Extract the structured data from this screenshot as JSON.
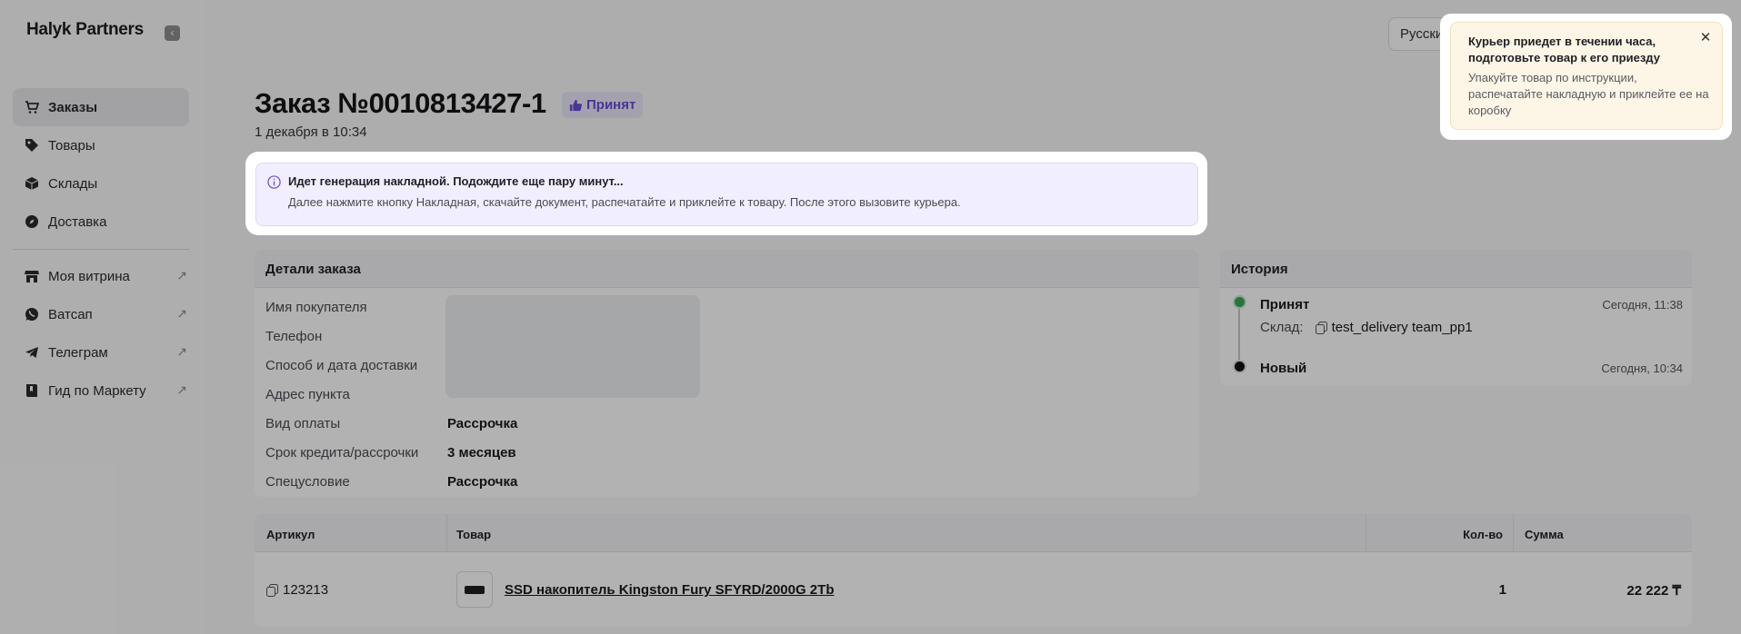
{
  "sidebar": {
    "brand": "Halyk Partners",
    "collapse_icon": "chevron-left-icon",
    "main_items": [
      {
        "label": "Заказы",
        "icon": "cart-icon",
        "active": true
      },
      {
        "label": "Товары",
        "icon": "tag-icon",
        "active": false
      },
      {
        "label": "Склады",
        "icon": "box-icon",
        "active": false
      },
      {
        "label": "Доставка",
        "icon": "compass-icon",
        "active": false
      }
    ],
    "external_items": [
      {
        "label": "Моя витрина",
        "icon": "store-icon"
      },
      {
        "label": "Ватсап",
        "icon": "whatsapp-icon"
      },
      {
        "label": "Телеграм",
        "icon": "telegram-icon"
      },
      {
        "label": "Гид по Маркету",
        "icon": "book-icon"
      }
    ],
    "external_arrow": "↗"
  },
  "header": {
    "language": "Русский"
  },
  "order": {
    "title": "Заказ №0010813427-1",
    "status": "Принят",
    "date": "1 декабря в 10:34"
  },
  "banner": {
    "title": "Идет генерация накладной. Подождите еще пару минут...",
    "text": "Далее нажмите кнопку Накладная, скачайте документ, распечатайте и приклейте к товару. После этого вызовите курьера."
  },
  "details": {
    "header": "Детали заказа",
    "rows": [
      {
        "label": "Имя покупателя",
        "value": ""
      },
      {
        "label": "Телефон",
        "value": ""
      },
      {
        "label": "Способ и дата доставки",
        "value": ""
      },
      {
        "label": "Адрес пункта",
        "value": ""
      },
      {
        "label": "Вид оплаты",
        "value": "Рассрочка"
      },
      {
        "label": "Срок кредита/рассрочки",
        "value": "3 месяцев"
      },
      {
        "label": "Спецусловие",
        "value": "Рассрочка"
      }
    ]
  },
  "history": {
    "header": "История",
    "events": [
      {
        "title": "Принят",
        "time": "Сегодня, 11:38",
        "sub_label": "Склад:",
        "sub_value": "test_delivery team_pp1",
        "dot_color": "#3aa757"
      },
      {
        "title": "Новый",
        "time": "Сегодня, 10:34",
        "dot_color": "#111111"
      }
    ]
  },
  "items_table": {
    "columns": [
      "Артикул",
      "Товар",
      "Кол-во",
      "Сумма"
    ],
    "rows": [
      {
        "article": "123213",
        "product": "SSD накопитель Kingston Fury SFYRD/2000G 2Tb",
        "qty": "1",
        "sum": "22 222 ₸"
      }
    ]
  },
  "toast": {
    "title": "Курьер приедет в течении часа, подготовьте товар к его приезду",
    "text": "Упакуйте товар по инструкции, распечатайте накладную и приклейте ее на коробку",
    "close": "✕"
  },
  "colors": {
    "accent": "#6a4bd6",
    "banner_bg": "#f1efff",
    "toast_bg": "#fdf6e6",
    "overlay": "rgba(0,0,0,0.30)"
  }
}
